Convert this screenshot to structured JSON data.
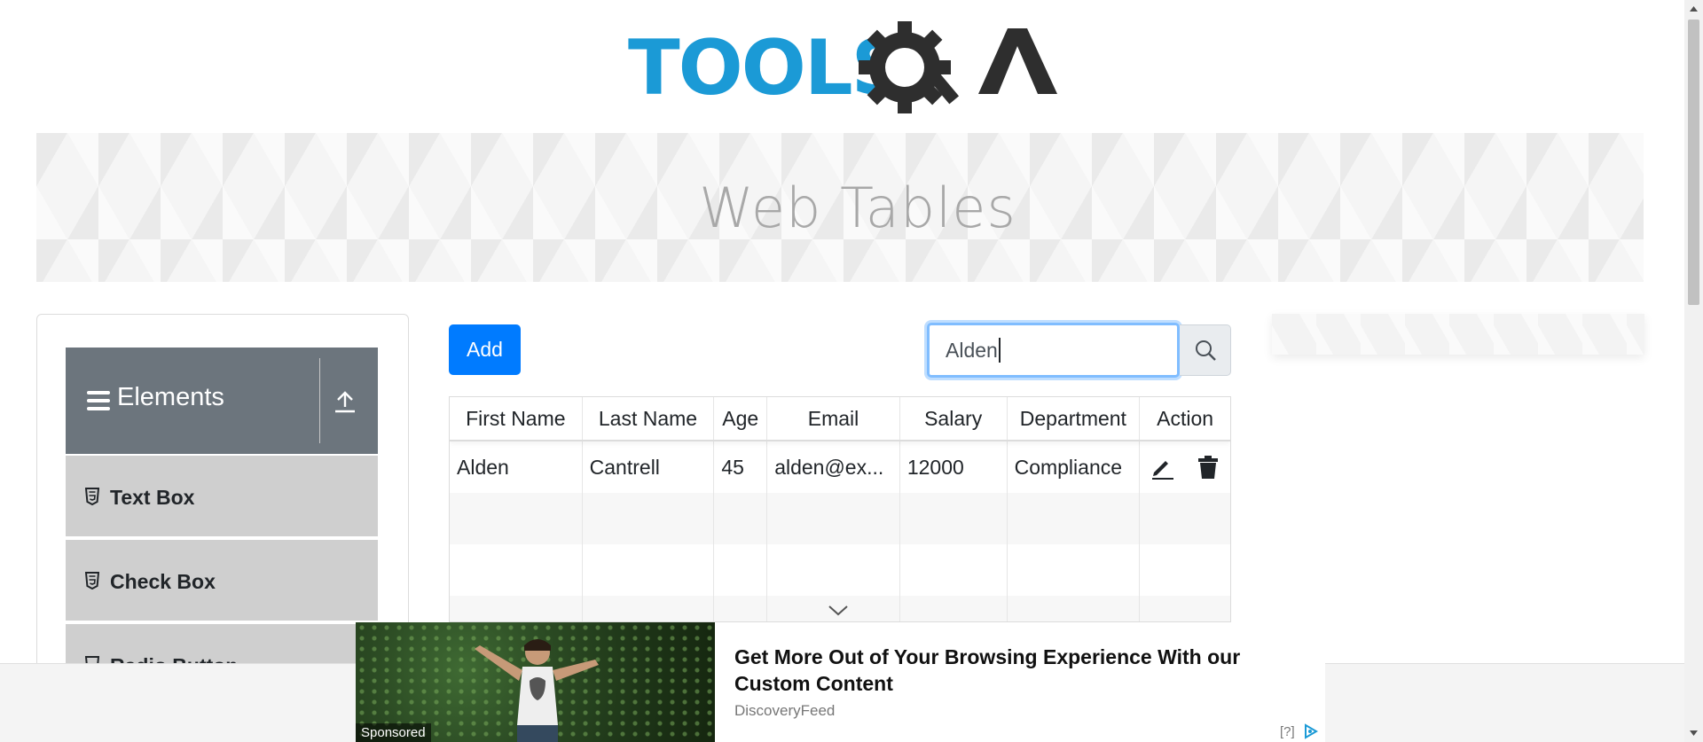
{
  "logo": {
    "text": "TOOLSQA"
  },
  "banner": {
    "title": "Web Tables"
  },
  "sidebar": {
    "group_title": "Elements",
    "items": [
      {
        "label": "Text Box"
      },
      {
        "label": "Check Box"
      },
      {
        "label": "Radio Button"
      }
    ]
  },
  "toolbar": {
    "add_label": "Add",
    "search_value": "Alden"
  },
  "table": {
    "headers": [
      "First Name",
      "Last Name",
      "Age",
      "Email",
      "Salary",
      "Department",
      "Action"
    ],
    "rows": [
      [
        "Alden",
        "Cantrell",
        "45",
        "alden@ex...",
        "12000",
        "Compliance"
      ]
    ]
  },
  "ad": {
    "tag": "Sponsored",
    "headline": "Get More Out of Your Browsing Experience With our Custom Content",
    "source": "DiscoveryFeed",
    "help": "[?]"
  },
  "colors": {
    "primary": "#007bff",
    "sidebar_header": "#6c757d",
    "logo_blue": "#1b9ad6",
    "logo_dark": "#2e2e2e"
  }
}
